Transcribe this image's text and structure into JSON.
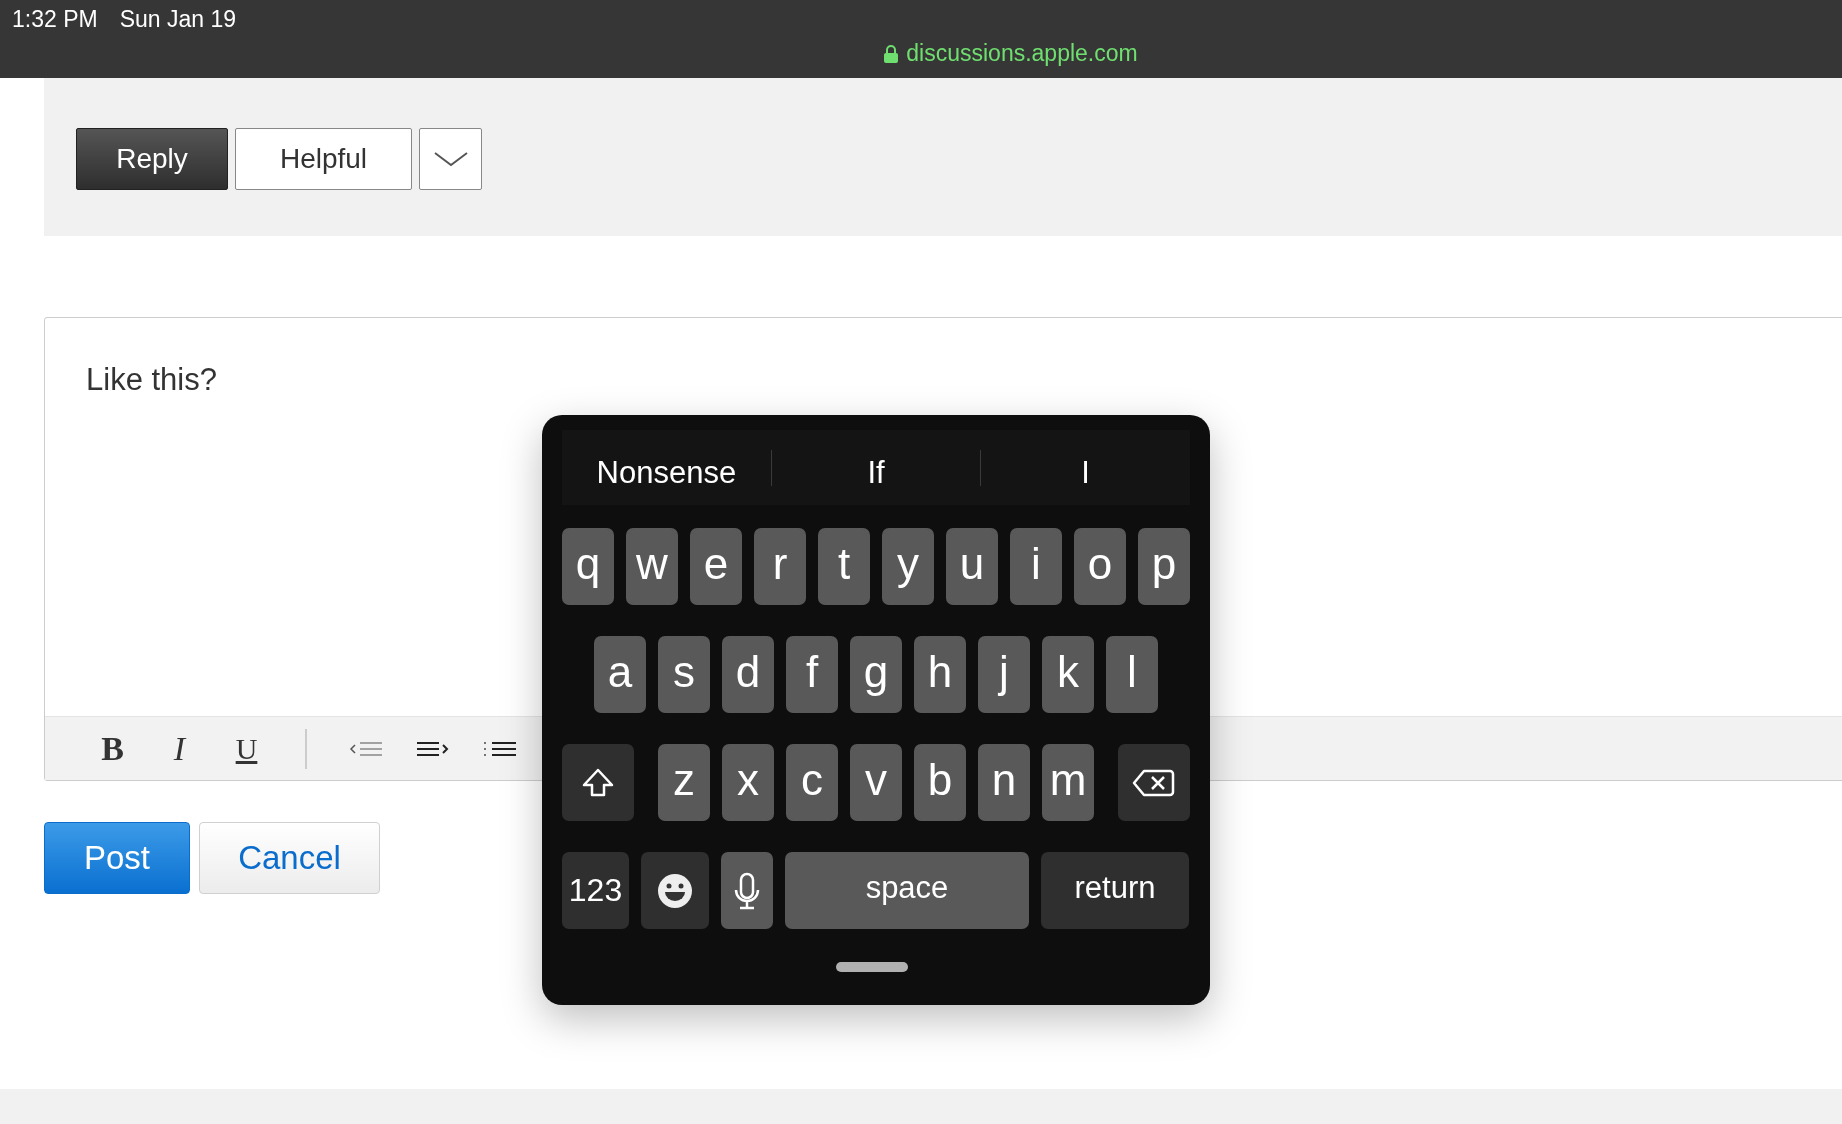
{
  "status_bar": {
    "time": "1:32 PM",
    "date": "Sun Jan 19",
    "url": "discussions.apple.com"
  },
  "reply_actions": {
    "reply": "Reply",
    "helpful": "Helpful"
  },
  "editor": {
    "text": "Like this?",
    "toolbar": [
      {
        "kind": "bold",
        "label": "B"
      },
      {
        "kind": "italic",
        "label": "I"
      },
      {
        "kind": "underline",
        "label": "U"
      },
      {
        "kind": "divider"
      },
      {
        "kind": "outdent"
      },
      {
        "kind": "indent"
      },
      {
        "kind": "numbered-list"
      }
    ]
  },
  "form_buttons": {
    "post": "Post",
    "cancel": "Cancel"
  },
  "keyboard": {
    "suggestions": [
      "Nonsense",
      "If",
      "I"
    ],
    "rows": [
      {
        "keys": [
          {
            "kind": "letter",
            "label": "q"
          },
          {
            "kind": "letter",
            "label": "w"
          },
          {
            "kind": "letter",
            "label": "e"
          },
          {
            "kind": "letter",
            "label": "r"
          },
          {
            "kind": "letter",
            "label": "t"
          },
          {
            "kind": "letter",
            "label": "y"
          },
          {
            "kind": "letter",
            "label": "u"
          },
          {
            "kind": "letter",
            "label": "i"
          },
          {
            "kind": "letter",
            "label": "o"
          },
          {
            "kind": "letter",
            "label": "p"
          }
        ]
      },
      {
        "keys": [
          {
            "kind": "letter",
            "label": "a"
          },
          {
            "kind": "letter",
            "label": "s"
          },
          {
            "kind": "letter",
            "label": "d"
          },
          {
            "kind": "letter",
            "label": "f"
          },
          {
            "kind": "letter",
            "label": "g"
          },
          {
            "kind": "letter",
            "label": "h"
          },
          {
            "kind": "letter",
            "label": "j"
          },
          {
            "kind": "letter",
            "label": "k"
          },
          {
            "kind": "letter",
            "label": "l"
          }
        ]
      },
      {
        "keys": [
          {
            "kind": "shift"
          },
          {
            "kind": "letter",
            "label": "z"
          },
          {
            "kind": "letter",
            "label": "x"
          },
          {
            "kind": "letter",
            "label": "c"
          },
          {
            "kind": "letter",
            "label": "v"
          },
          {
            "kind": "letter",
            "label": "b"
          },
          {
            "kind": "letter",
            "label": "n"
          },
          {
            "kind": "letter",
            "label": "m"
          },
          {
            "kind": "delete"
          }
        ]
      },
      {
        "keys": [
          {
            "kind": "numbers",
            "label": "123"
          },
          {
            "kind": "emoji"
          },
          {
            "kind": "mic"
          },
          {
            "kind": "space",
            "label": "space"
          },
          {
            "kind": "return",
            "label": "return"
          }
        ]
      }
    ]
  }
}
